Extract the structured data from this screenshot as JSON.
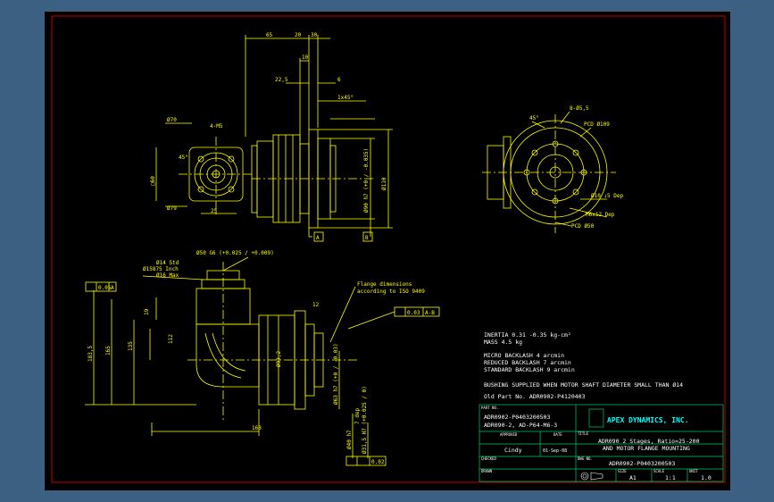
{
  "colors": {
    "background": "#3b6082",
    "canvas": "#000000",
    "border": "#c00000",
    "line": "#ffff00",
    "cyan": "#00ffff",
    "white": "#ffffff"
  },
  "top_view": {
    "dims": {
      "d65": "65",
      "d20": "20",
      "d30": "30",
      "d10": "10",
      "d22": "22,5",
      "d6": "6",
      "chamfer": "1x45°",
      "d110": "Ø110",
      "d90": "Ø90 h7 (+0 / -0.035)",
      "datum_a": "A",
      "datum_b": "B"
    }
  },
  "left_view": {
    "dims": {
      "d70": "Ø70",
      "h4": "4-M5",
      "a45": "45°",
      "sq": "□60",
      "d79": "Ø79",
      "d25": "25"
    }
  },
  "right_view": {
    "dims": {
      "a45": "45°",
      "holes": "8-Ø5,5",
      "pcd109": "PCD Ø109",
      "d10": "Ø10 ↓5 Dep",
      "m6": "M6x12 Dep",
      "pcd50": "PCD Ø50"
    }
  },
  "bottom_view": {
    "dims": {
      "d14": "Ø14 Std",
      "d15": "Ø15875 Inch",
      "d16": "Ø16 Max",
      "d50": "Ø50 G6 (+0.025 / +0.009)",
      "flat": "0.05",
      "flat_datum": "A",
      "note1": "Flange dimensions",
      "note2": "according to ISO 9409",
      "d12": "12",
      "runout": "0.03",
      "runout_datum": "A-B",
      "d19": "19",
      "d112": "112",
      "d135": "135",
      "d165": "165",
      "d183": "183,5",
      "d163": "163",
      "d93": "Ø93,2",
      "d63": "Ø63 h7 (+0 / -0.03)",
      "d31": "Ø31,5 H7 (+0.025 / 0)",
      "d40": "Ø40 h7",
      "dep": "7 dep",
      "pos": "0.02"
    }
  },
  "specs": [
    "INERTIA 0.31 -0.35 kg-cm²",
    "MASS 4.5 kg",
    "MICRO BACKLASH 4 arcmin",
    "REDUCED BACKLASH 7 arcmin",
    "STANDARD BACKLASH 9 arcmin",
    "BUSHING SUPPLIED WHEN MOTOR SHAFT DIAMETER SMALL THAN Ø14",
    "Old Part No. ADR0902-P4120403"
  ],
  "title_block": {
    "part_no_label": "PART NO.",
    "part_no_1": "ADR0902-P0403200503",
    "part_no_2": "ADR090-2, AD-P64-M6-3",
    "company": "APEX DYNAMICS, INC.",
    "approved_label": "APPROVED",
    "date_label": "DATE",
    "approver": "Cindy",
    "date": "01-Sep-08",
    "checked_label": "CHECKED",
    "title_label": "TITLE",
    "title_1": "ADR090 2 Stages, Ratio=25-200",
    "title_2": "AND MOTOR FLANGE MOUNTING",
    "dwg_label": "DWG NO.",
    "dwg_no": "ADR0902-P0403200503",
    "drawn_label": "DRAWN",
    "size_label": "SIZE",
    "scale_label": "SCALE",
    "unit_label": "UNIT",
    "size": "A1",
    "scale": "1:1",
    "unit": "1.0"
  }
}
